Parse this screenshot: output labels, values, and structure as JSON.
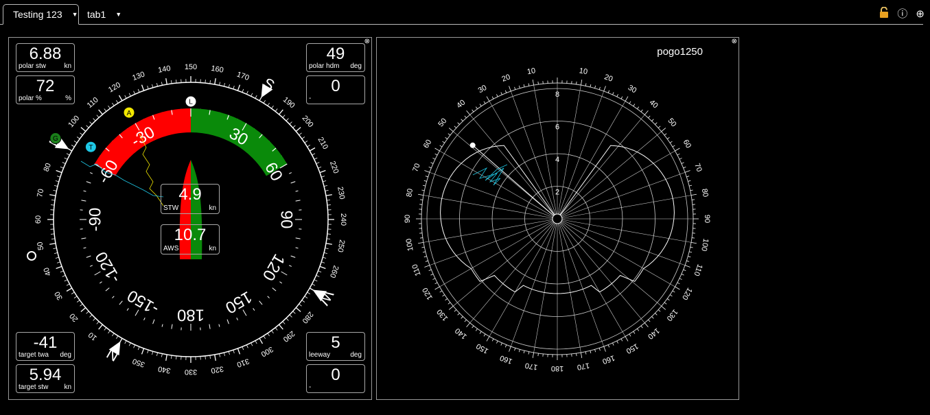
{
  "tabs": [
    {
      "label": "Testing 123",
      "active": true
    },
    {
      "label": "tab1",
      "active": false
    }
  ],
  "toolbar": {
    "icons": [
      "lock-icon",
      "info-icon",
      "add-icon"
    ]
  },
  "gauge": {
    "boxes": {
      "polar_stw": {
        "value": "6.88",
        "label": "polar stw",
        "unit": "kn"
      },
      "polar_pct": {
        "value": "72",
        "label": "polar %",
        "unit": "%"
      },
      "polar_hdm": {
        "value": "49",
        "label": "polar hdm",
        "unit": "deg"
      },
      "blank_top": {
        "value": "0",
        "label": "-",
        "unit": ""
      },
      "target_twa": {
        "value": "-41",
        "label": "target twa",
        "unit": "deg"
      },
      "target_stw": {
        "value": "5.94",
        "label": "target stw",
        "unit": "kn"
      },
      "leeway": {
        "value": "5",
        "label": "leeway",
        "unit": "deg"
      },
      "blank_bottom": {
        "value": "0",
        "label": "-",
        "unit": ""
      }
    },
    "stw": {
      "value": "4.9",
      "label": "STW",
      "unit": "kn"
    },
    "aws": {
      "value": "10.7",
      "label": "AWS",
      "unit": "kn"
    },
    "heading_deg": 150,
    "compass_cardinals": [
      {
        "letter": "S",
        "bearing": 180
      },
      {
        "letter": "W",
        "bearing": 270
      },
      {
        "letter": "N",
        "bearing": 0
      },
      {
        "letter": "E",
        "bearing": 90
      }
    ],
    "relative_labels": [
      "30",
      "60",
      "90",
      "120",
      "150",
      "180",
      "-150",
      "-120",
      "-90",
      "-60",
      "-30"
    ],
    "markers": [
      {
        "letter": "L",
        "color": "#ffffff",
        "bearing": 150
      },
      {
        "letter": "A",
        "color": "#f2e800",
        "bearing": 120
      },
      {
        "letter": "T",
        "color": "#1ec8e6",
        "bearing": 96
      },
      {
        "letter": "G",
        "color": "#1a7f1a",
        "bearing": 91
      }
    ],
    "colors": {
      "port": "#ff0000",
      "starboard": "#0a8a0a",
      "apparent": "#f2e800",
      "true_wind": "#1ec8e6"
    }
  },
  "polar": {
    "title": "pogo1250",
    "radial_labels": [
      "2",
      "4",
      "6",
      "8"
    ],
    "angle_labels": [
      "10",
      "20",
      "30",
      "40",
      "50",
      "60",
      "70",
      "80",
      "90",
      "100",
      "110",
      "120",
      "130",
      "140",
      "150",
      "160",
      "170",
      "180"
    ],
    "colors": {
      "grid": "#cccccc",
      "track": "#1ec8e6"
    }
  }
}
